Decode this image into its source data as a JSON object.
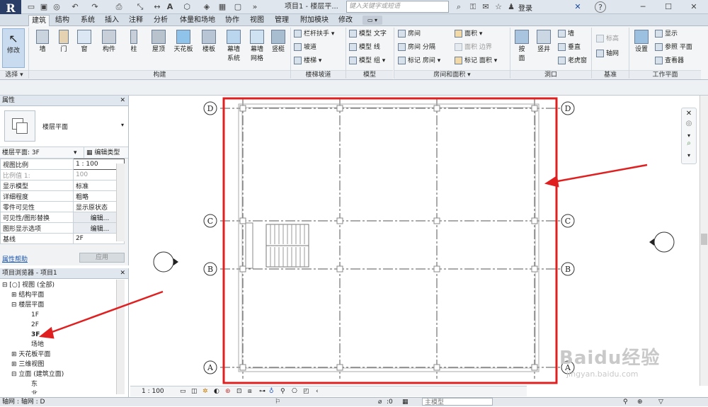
{
  "app": {
    "logo_letter": "R",
    "title": "项目1 - 楼层平...",
    "search_placeholder": "键入关键字或短语",
    "login": "登录",
    "help": "?"
  },
  "tabs": [
    "建筑",
    "结构",
    "系统",
    "插入",
    "注释",
    "分析",
    "体量和场地",
    "协作",
    "视图",
    "管理",
    "附加模块",
    "修改"
  ],
  "ribbon": {
    "modify": "修改",
    "select": "选择 ▾",
    "build": {
      "wall": "墙",
      "door": "门",
      "window": "窗",
      "component": "构件",
      "column": "柱",
      "roof": "屋顶",
      "ceiling": "天花板",
      "floor": "楼板",
      "curtain_system": "幕墙\n系统",
      "curtain_grid": "幕墙\n网格",
      "mullion": "竖梃",
      "group_label": "构建"
    },
    "circulation": {
      "railing": "栏杆扶手",
      "ramp": "坡道",
      "stair": "楼梯",
      "group_label": "楼梯坡道"
    },
    "model": {
      "text": "模型 文字",
      "line": "模型 线",
      "group": "模型 组",
      "group_label": "模型"
    },
    "room": {
      "room": "房间",
      "separator": "房间 分隔",
      "tag": "标记 房间",
      "area": "面积",
      "area_boundary": "面积 边界",
      "tag_area": "标记 面积",
      "group_label": "房间和面积 ▾"
    },
    "opening": {
      "by_face": "按\n面",
      "shaft": "竖井",
      "wall": "墙",
      "vertical": "垂直",
      "dormer": "老虎窗",
      "group_label": "洞口"
    },
    "datum": {
      "level": "标高",
      "grid": "轴网",
      "group_label": "基准"
    },
    "workplane": {
      "set": "设置",
      "show": "显示",
      "ref_plane": "参照 平面",
      "viewer": "查看器",
      "group_label": "工作平面"
    }
  },
  "properties": {
    "header": "属性",
    "type_name": "楼层平面",
    "type_selector": "楼层平面: 3F",
    "edit_type": "编辑类型",
    "rows": [
      {
        "k": "视图比例",
        "v": "1 : 100"
      },
      {
        "k": "比例值 1:",
        "v": "100"
      },
      {
        "k": "显示模型",
        "v": "标准"
      },
      {
        "k": "详细程度",
        "v": "粗略"
      },
      {
        "k": "零件可见性",
        "v": "显示原状态"
      },
      {
        "k": "可见性/图形替换",
        "v": "编辑..."
      },
      {
        "k": "图形显示选项",
        "v": "编辑..."
      },
      {
        "k": "基线",
        "v": "2F"
      }
    ],
    "help_link": "属性帮助",
    "apply": "应用"
  },
  "browser": {
    "header": "项目浏览器 - 项目1",
    "items": [
      "[○] 视图 (全部)",
      "结构平面",
      "楼层平面",
      "1F",
      "2F",
      "3F",
      "场地",
      "天花板平面",
      "三维视图",
      "立面 (建筑立面)",
      "东",
      "北"
    ]
  },
  "canvas": {
    "grid_labels": [
      "D",
      "C",
      "B",
      "A"
    ],
    "accent": "#e02020"
  },
  "viewbar": {
    "scale": "1 : 100"
  },
  "status": {
    "left": "轴网 : 轴网 : D",
    "zero": ":0",
    "model": "主模型"
  },
  "watermark": "Baidu经验",
  "watermark_url": "jingyan.baidu.com"
}
